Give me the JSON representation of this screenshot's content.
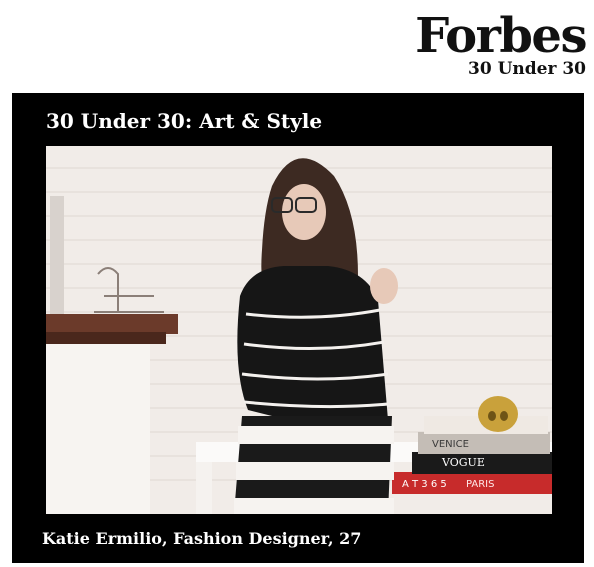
{
  "brand": {
    "name": "Forbes",
    "subtitle": "30 Under 30"
  },
  "section": {
    "title": "30 Under 30: Art & Style"
  },
  "photo": {
    "book_spines": [
      "VENICE",
      "VOGUE",
      "PARIS",
      "A T 3 6 5"
    ]
  },
  "caption": "Katie Ermilio, Fashion Designer, 27",
  "colors": {
    "panel": "#000000",
    "text_on_panel": "#ffffff",
    "brand": "#111111"
  }
}
